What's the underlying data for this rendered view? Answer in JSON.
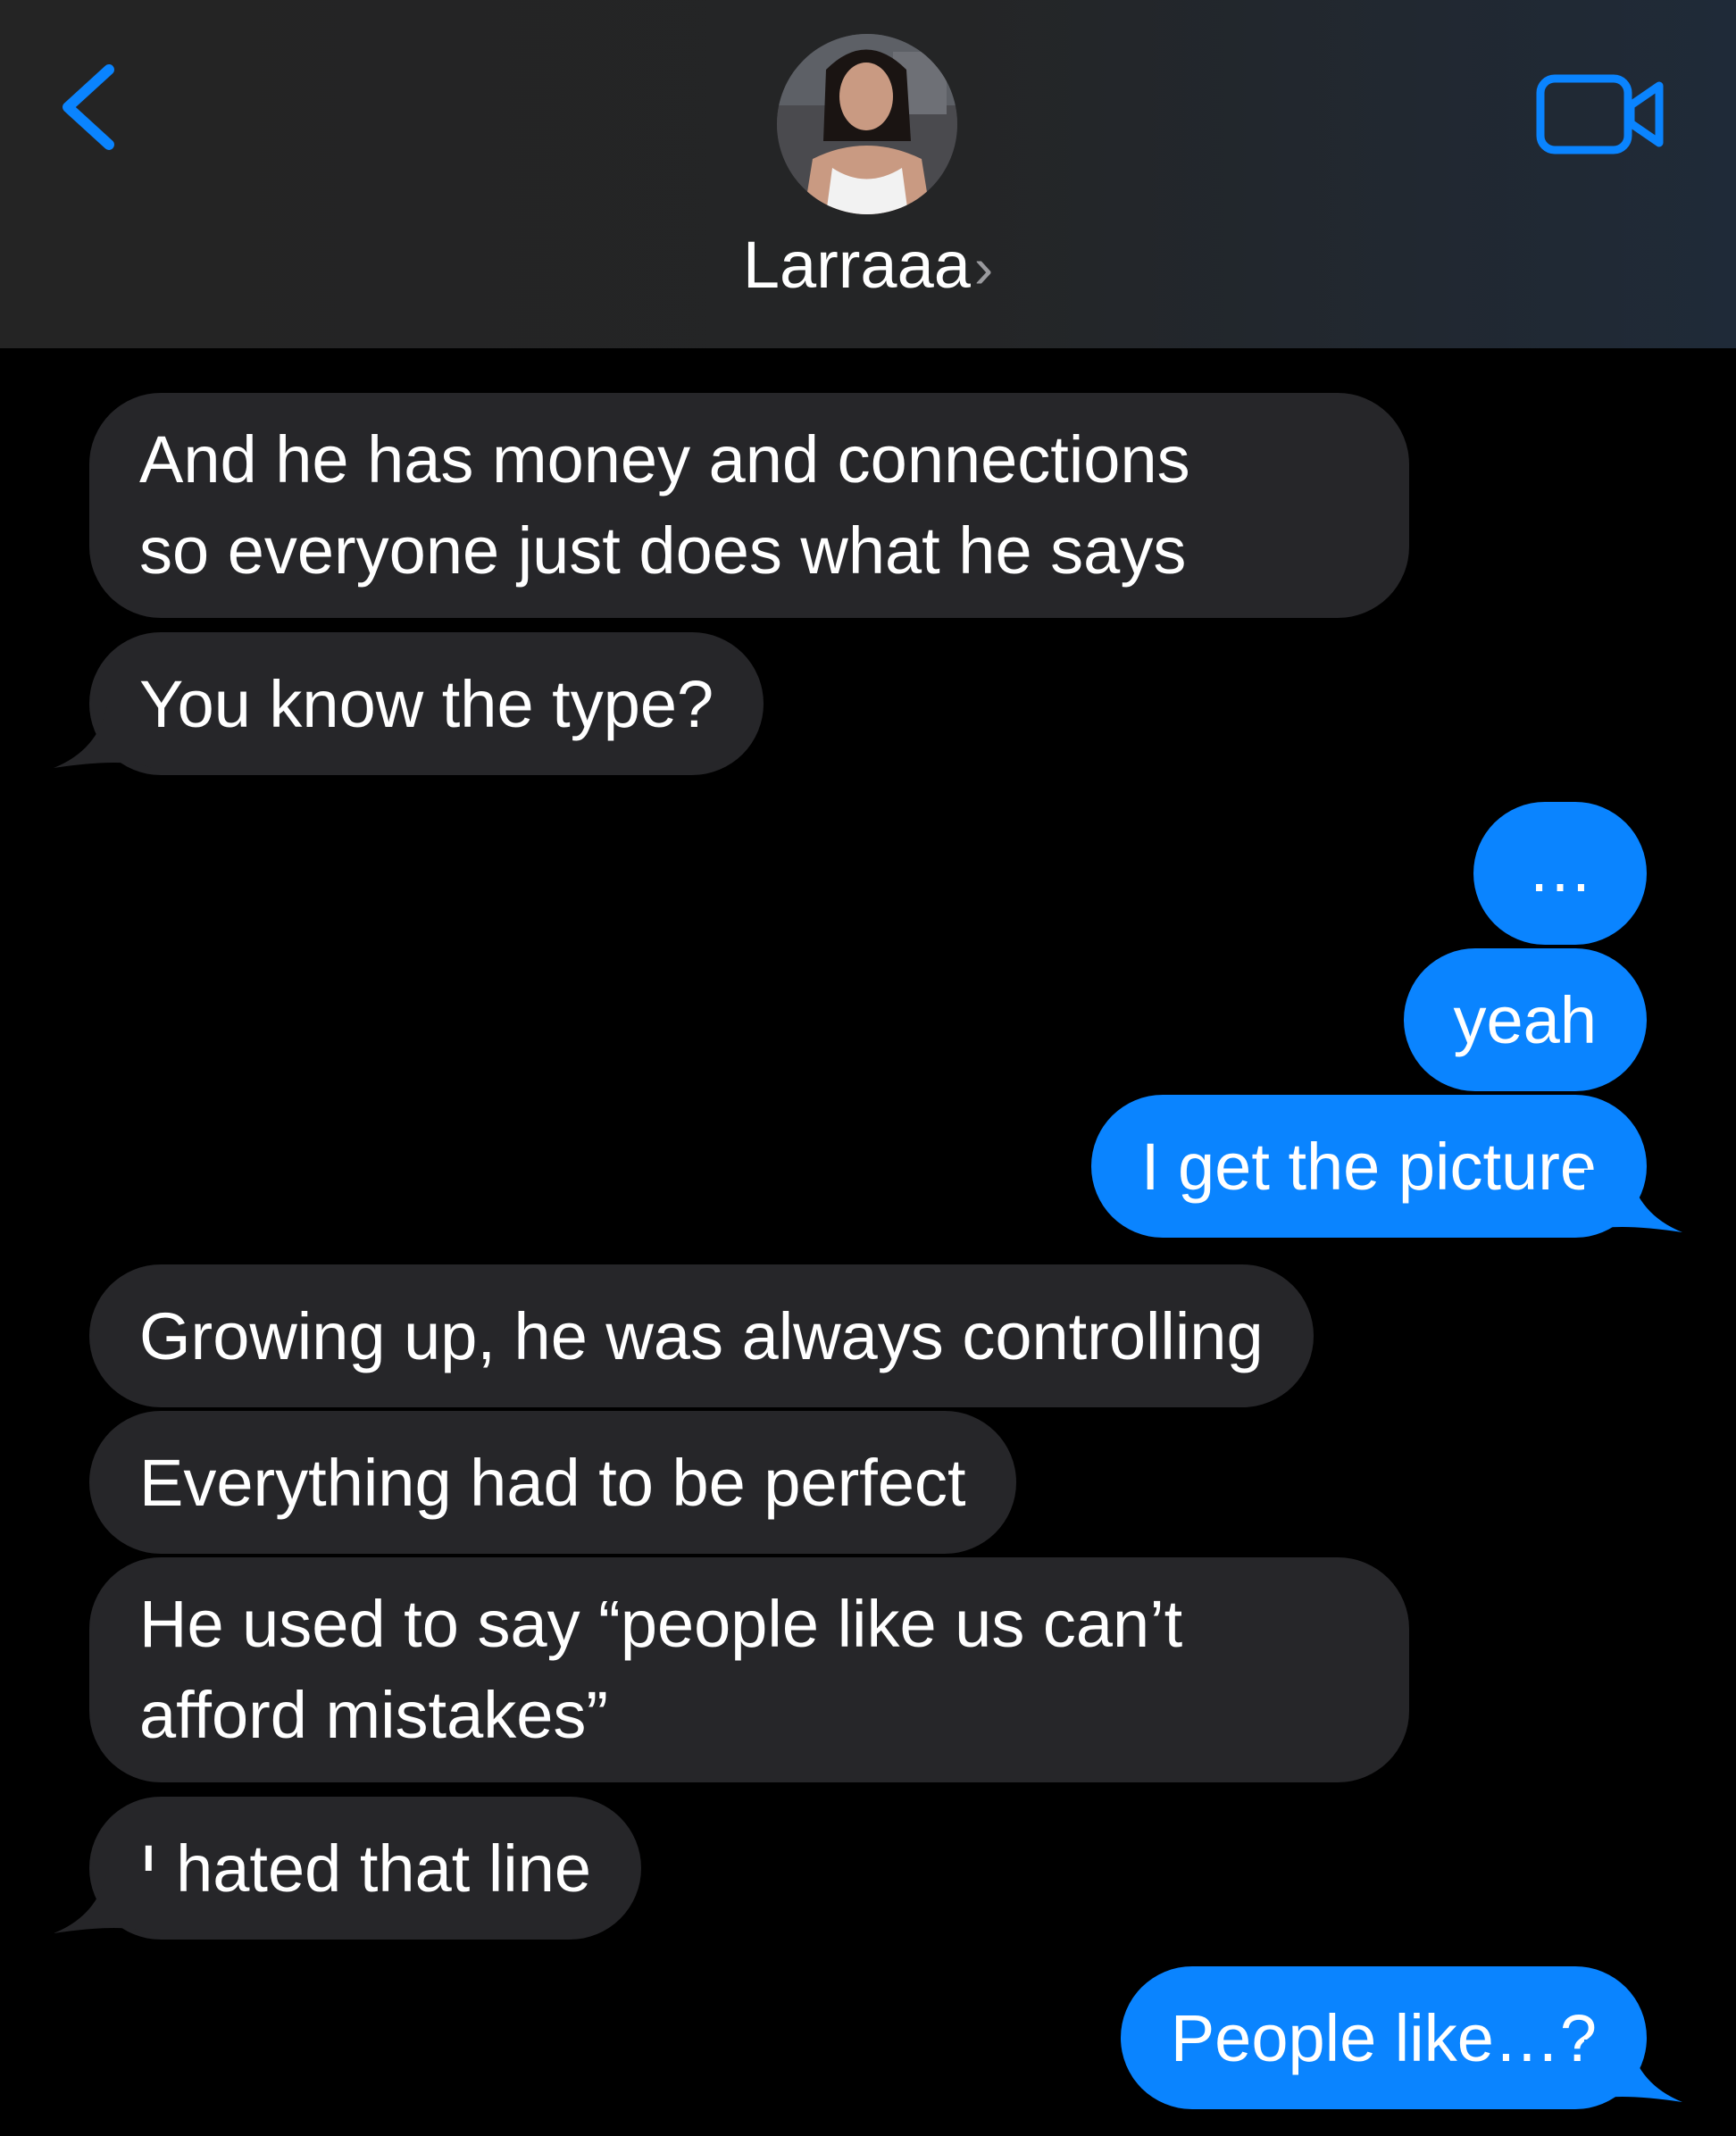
{
  "header": {
    "contact_name": "Larraaa",
    "chevron": "›",
    "back_icon": "chevron-left-icon",
    "video_icon": "video-camera-icon",
    "accent_color": "#0a84ff"
  },
  "messages": [
    {
      "direction": "incoming",
      "lines": [
        "And he has money and connections",
        "so everyone just does what he says"
      ]
    },
    {
      "direction": "incoming",
      "lines": [
        "You know the type?"
      ]
    },
    {
      "direction": "outgoing",
      "lines": [
        "…"
      ]
    },
    {
      "direction": "outgoing",
      "lines": [
        "yeah"
      ]
    },
    {
      "direction": "outgoing",
      "lines": [
        "I get the picture"
      ]
    },
    {
      "direction": "incoming",
      "lines": [
        "Growing up, he was always controlling"
      ]
    },
    {
      "direction": "incoming",
      "lines": [
        "Everything had to be perfect"
      ]
    },
    {
      "direction": "incoming",
      "lines": [
        "He used to say “people like us can’t",
        "afford mistakes”"
      ]
    },
    {
      "direction": "incoming",
      "lines": [
        "I hated that line"
      ]
    },
    {
      "direction": "outgoing",
      "lines": [
        "People like…?"
      ]
    }
  ],
  "colors": {
    "incoming_bubble": "#262629",
    "outgoing_bubble": "#0a84ff",
    "background": "#000000"
  }
}
